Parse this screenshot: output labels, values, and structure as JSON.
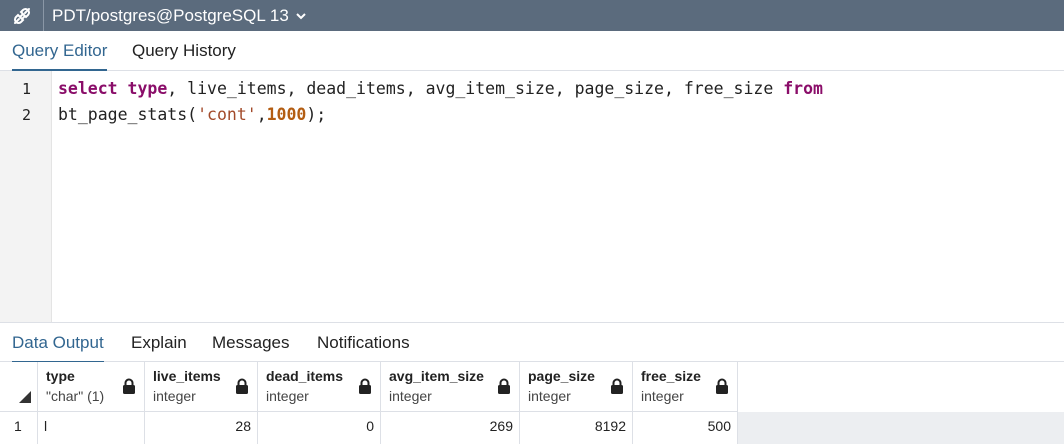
{
  "connection": {
    "title": "PDT/postgres@PostgreSQL 13",
    "icon": "connection-plug-icon"
  },
  "editor_tabs": [
    {
      "label": "Query Editor",
      "active": true
    },
    {
      "label": "Query History",
      "active": false
    }
  ],
  "editor": {
    "line_numbers": [
      "1",
      "2"
    ],
    "line1": {
      "kw_select": "select",
      "kw_type": "type",
      "cols": ", live_items, dead_items, avg_item_size, page_size, free_size ",
      "kw_from": "from"
    },
    "line2": {
      "fn": "bt_page_stats(",
      "str": "'cont'",
      "comma": ",",
      "num": "1000",
      "end": ");"
    }
  },
  "output_tabs": [
    {
      "label": "Data Output",
      "active": true
    },
    {
      "label": "Explain",
      "active": false
    },
    {
      "label": "Messages",
      "active": false
    },
    {
      "label": "Notifications",
      "active": false
    }
  ],
  "grid": {
    "columns": [
      {
        "name": "type",
        "type": "\"char\" (1)"
      },
      {
        "name": "live_items",
        "type": "integer"
      },
      {
        "name": "dead_items",
        "type": "integer"
      },
      {
        "name": "avg_item_size",
        "type": "integer"
      },
      {
        "name": "page_size",
        "type": "integer"
      },
      {
        "name": "free_size",
        "type": "integer"
      }
    ],
    "rows": [
      {
        "row_number": "1",
        "cells": [
          "l",
          "28",
          "0",
          "269",
          "8192",
          "500"
        ]
      }
    ]
  },
  "colors": {
    "topbar": "#5b6b7d",
    "accent": "#326690",
    "keyword": "#8a0d69",
    "string": "#a24a2a",
    "number": "#b35d12"
  }
}
